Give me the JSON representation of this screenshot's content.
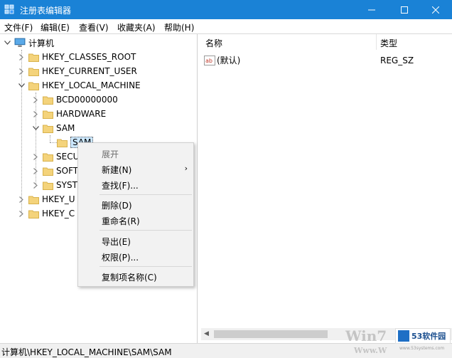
{
  "window": {
    "title": "注册表编辑器"
  },
  "menu": [
    "文件(F)",
    "编辑(E)",
    "查看(V)",
    "收藏夹(A)",
    "帮助(H)"
  ],
  "tree": {
    "root": "计算机",
    "hkcr": "HKEY_CLASSES_ROOT",
    "hkcu": "HKEY_CURRENT_USER",
    "hklm": "HKEY_LOCAL_MACHINE",
    "bcd": "BCD00000000",
    "hardware": "HARDWARE",
    "sam": "SAM",
    "sam_child": "SAM",
    "security": "SECU",
    "software": "SOFT",
    "system": "SYST",
    "hku": "HKEY_U",
    "hkcc": "HKEY_C"
  },
  "list": {
    "col_name": "名称",
    "col_type": "类型",
    "rows": [
      {
        "name": "(默认)",
        "type": "REG_SZ"
      }
    ],
    "icon_text": "ab"
  },
  "context_menu": {
    "expand": "展开",
    "new": "新建(N)",
    "find": "查找(F)...",
    "delete": "删除(D)",
    "rename": "重命名(R)",
    "export": "导出(E)",
    "permissions": "权限(P)...",
    "copy_key_name": "复制项名称(C)"
  },
  "status": {
    "path": "计算机\\HKEY_LOCAL_MACHINE\\SAM\\SAM"
  },
  "watermark": {
    "win": "Win7",
    "badge": "53软件园",
    "url": "www.53systems.com",
    "www": "Www.W"
  },
  "colors": {
    "titlebar": "#1a82d6",
    "folder": "#f4d37b",
    "selection": "#cce8ff"
  }
}
